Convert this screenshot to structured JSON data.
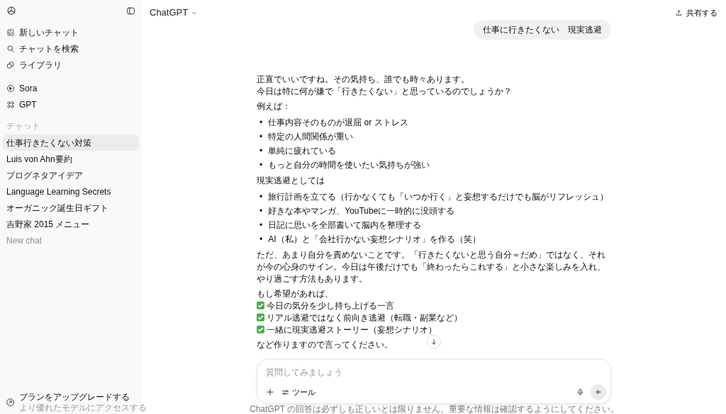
{
  "sidebar": {
    "nav": [
      {
        "kind": "new",
        "label": "新しいチャット"
      },
      {
        "kind": "search",
        "label": "チャットを検索"
      },
      {
        "kind": "library",
        "label": "ライブラリ"
      }
    ],
    "apps": [
      {
        "kind": "sora",
        "label": "Sora"
      },
      {
        "kind": "gpt",
        "label": "GPT"
      }
    ],
    "section_label": "チャット",
    "chats": [
      {
        "title": "仕事行きたくない対策",
        "selected": true
      },
      {
        "title": "Luis von Ahn要約",
        "selected": false
      },
      {
        "title": "ブログネタアイデア",
        "selected": false
      },
      {
        "title": "Language Learning Secrets",
        "selected": false
      },
      {
        "title": "オーガニック誕生日ギフト",
        "selected": false
      },
      {
        "title": "吉野家 2015 メニュー",
        "selected": false
      },
      {
        "title": "New chat",
        "selected": false,
        "muted": true
      }
    ],
    "upgrade": {
      "title": "プランをアップグレードする",
      "subtitle": "より優れたモデルにアクセスする"
    }
  },
  "header": {
    "model": "ChatGPT",
    "share": "共有する"
  },
  "user_message": "仕事に行きたくない　現実逃避",
  "response": [
    {
      "kind": "paragraph",
      "lines": [
        "正直でいいですね。その気持ち、誰でも時々あります。",
        "今日は特に何が嫌で「行きたくない」と思っているのでしょうか？"
      ]
    },
    {
      "kind": "paragraph",
      "lines": [
        "例えば："
      ]
    },
    {
      "kind": "list",
      "marker": "•",
      "items": [
        "仕事内容そのものが退屈 or ストレス",
        "特定の人間関係が重い",
        "単純に疲れている",
        "もっと自分の時間を使いたい気持ちが強い"
      ]
    },
    {
      "kind": "paragraph",
      "lines": [
        "現実逃避としては"
      ]
    },
    {
      "kind": "list",
      "marker": "•",
      "items": [
        "旅行計画を立てる（行かなくても「いつか行く」と妄想するだけでも脳がリフレッシュ）",
        "好きな本やマンガ、YouTubeに一時的に没頭する",
        "日記に思いを全部書いて脳内を整理する",
        "AI（私）と「会社行かない妄想シナリオ」を作る（笑）"
      ]
    },
    {
      "kind": "paragraph",
      "lines": [
        "ただ、あまり自分を責めないことです。「行きたくないと思う自分＝だめ」ではなく、それが今の心身のサイン。今日は午後だけでも「終わったらこれする」と小さな楽しみを入れ、やり過ごす方法もあります。"
      ]
    },
    {
      "kind": "checklist",
      "lead": "もし希望があれば、",
      "items": [
        "今日の気分を少し持ち上げる一言",
        "リアル逃避ではなく前向き逃避（転職・副業など）",
        "一緒に現実逃避ストーリー（妄想シナリオ）"
      ]
    },
    {
      "kind": "paragraph",
      "lines": [
        "など作りますので言ってください。"
      ]
    }
  ],
  "composer": {
    "placeholder": "質問してみましょう",
    "tools": "ツール"
  },
  "disclaimer": "ChatGPT の回答は必ずしも正しいとは限りません。重要な情報は確認するようにしてください。"
}
